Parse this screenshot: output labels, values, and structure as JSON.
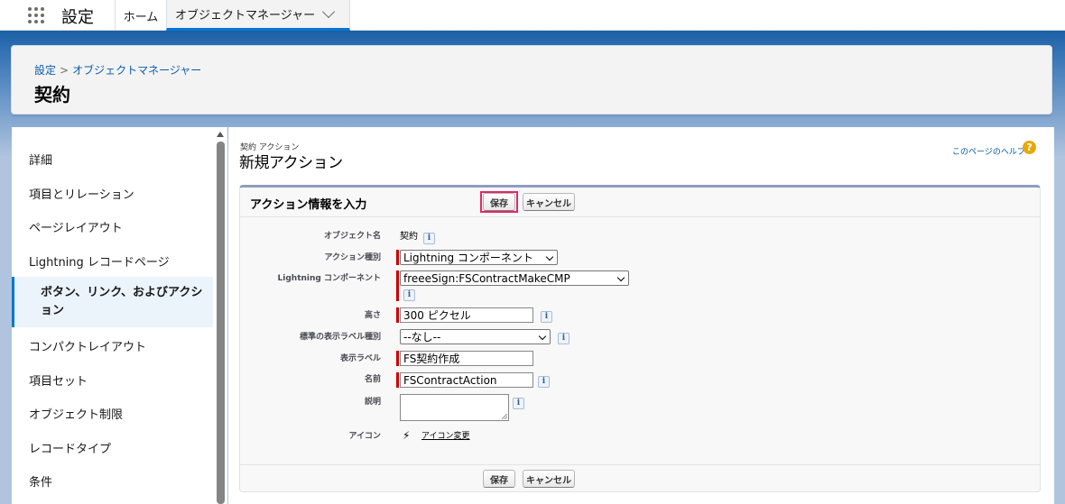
{
  "app": {
    "name": "設定"
  },
  "nav_tabs": {
    "home": "ホーム",
    "object_manager": "オブジェクトマネージャー"
  },
  "breadcrumb": {
    "root": "設定",
    "separator": ">",
    "current": "オブジェクトマネージャー"
  },
  "page": {
    "title": "契約"
  },
  "sidebar": {
    "items": [
      {
        "label": "詳細"
      },
      {
        "label": "項目とリレーション"
      },
      {
        "label": "ページレイアウト"
      },
      {
        "label": "Lightning レコードページ"
      },
      {
        "label": "ボタン、リンク、およびアクション",
        "active": true
      },
      {
        "label": "コンパクトレイアウト"
      },
      {
        "label": "項目セット"
      },
      {
        "label": "オブジェクト制限"
      },
      {
        "label": "レコードタイプ"
      },
      {
        "label": "条件"
      }
    ]
  },
  "main": {
    "eyebrow": "契約 アクション",
    "title": "新規アクション",
    "help_link": "このページのヘルプ",
    "help_icon": "?"
  },
  "form": {
    "section_title": "アクション情報を入力",
    "save_label": "保存",
    "cancel_label": "キャンセル",
    "info_glyph": "i",
    "fields": {
      "object_name": {
        "label": "オブジェクト名",
        "value": "契約"
      },
      "action_type": {
        "label": "アクション種別",
        "value": "Lightning コンポーネント"
      },
      "lightning_component": {
        "label": "Lightning コンポーネント",
        "value": "freeeSign:FSContractMakeCMP"
      },
      "height": {
        "label": "高さ",
        "value": "300 ピクセル"
      },
      "standard_label_type": {
        "label": "標準の表示ラベル種別",
        "value": "--なし--"
      },
      "display_label": {
        "label": "表示ラベル",
        "value": "FS契約作成"
      },
      "name": {
        "label": "名前",
        "value": "FSContractAction"
      },
      "description": {
        "label": "説明",
        "value": ""
      },
      "icon": {
        "label": "アイコン",
        "link": "アイコン変更",
        "glyph": "⚡"
      }
    }
  },
  "colors": {
    "brand_blue": "#0176d3",
    "required_bar": "#cc0000",
    "save_highlight": "#e5256b",
    "help_icon": "#e8a70b"
  }
}
